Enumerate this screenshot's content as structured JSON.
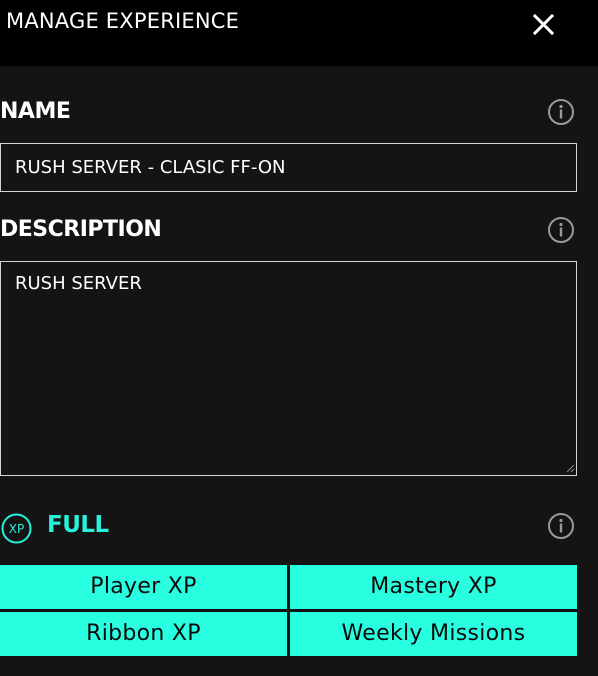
{
  "dialog": {
    "title": "MANAGE EXPERIENCE",
    "close_icon": "close-icon"
  },
  "name_section": {
    "label": "NAME",
    "value": "RUSH SERVER - CLASIC FF-ON",
    "info_icon": "info-icon"
  },
  "description_section": {
    "label": "DESCRIPTION",
    "value": "RUSH SERVER",
    "info_icon": "info-icon"
  },
  "xp_section": {
    "badge_text": "XP",
    "status": "FULL",
    "status_color": "#29f0d9",
    "info_icon": "info-icon",
    "buttons": [
      {
        "label": "Player XP"
      },
      {
        "label": "Mastery XP"
      },
      {
        "label": "Ribbon XP"
      },
      {
        "label": "Weekly Missions"
      }
    ]
  },
  "colors": {
    "accent": "#28ffe0",
    "background": "#141414",
    "titlebar": "#000000"
  }
}
